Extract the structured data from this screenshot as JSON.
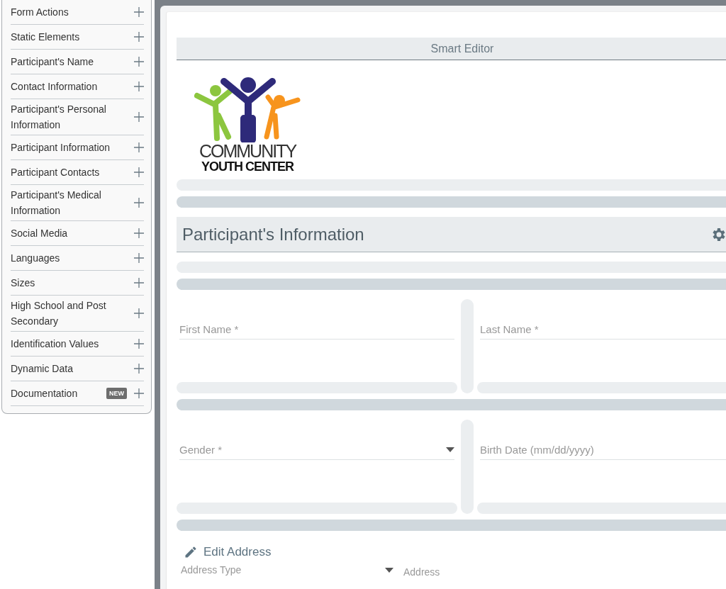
{
  "sidebar": {
    "items": [
      {
        "label": "Form Actions"
      },
      {
        "label": "Static Elements"
      },
      {
        "label": "Participant's Name"
      },
      {
        "label": "Contact Information"
      },
      {
        "label": "Participant's Personal Information"
      },
      {
        "label": "Participant Information"
      },
      {
        "label": "Participant Contacts"
      },
      {
        "label": "Participant's Medical Information"
      },
      {
        "label": "Social Media"
      },
      {
        "label": "Languages"
      },
      {
        "label": "Sizes"
      },
      {
        "label": "High School and Post Secondary"
      },
      {
        "label": "Identification Values"
      },
      {
        "label": "Dynamic Data"
      },
      {
        "label": "Documentation",
        "badge": "NEW"
      }
    ]
  },
  "editor": {
    "title": "Smart Editor",
    "logo": {
      "line1": "COMMUNITY",
      "line2": "YOUTH CENTER"
    },
    "section": {
      "title": "Participant's Information"
    },
    "field_rows": [
      [
        {
          "kind": "text",
          "placeholder": "First Name *"
        },
        {
          "kind": "text",
          "placeholder": "Last Name *"
        }
      ],
      [
        {
          "kind": "select",
          "placeholder": "Gender *"
        },
        {
          "kind": "date",
          "placeholder": "Birth Date (mm/dd/yyyy)"
        }
      ]
    ],
    "address": {
      "link": "Edit Address",
      "fields": [
        {
          "kind": "select",
          "placeholder": "Address Type"
        },
        {
          "kind": "text",
          "placeholder": "Address"
        }
      ]
    }
  }
}
